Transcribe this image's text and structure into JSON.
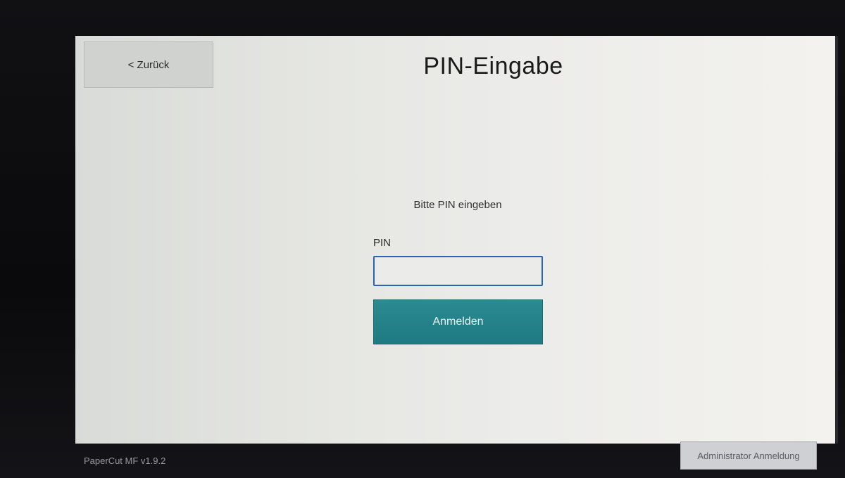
{
  "header": {
    "back_label": "< Zurück",
    "title": "PIN-Eingabe"
  },
  "form": {
    "prompt": "Bitte PIN eingeben",
    "pin_label": "PIN",
    "pin_value": "",
    "submit_label": "Anmelden"
  },
  "footer": {
    "version": "PaperCut MF v1.9.2",
    "admin_label": "Administrator Anmeldung"
  },
  "colors": {
    "accent_button": "#1f7a82",
    "focus_border": "#2c64b4",
    "screen_bg": "#e6e7e3"
  }
}
